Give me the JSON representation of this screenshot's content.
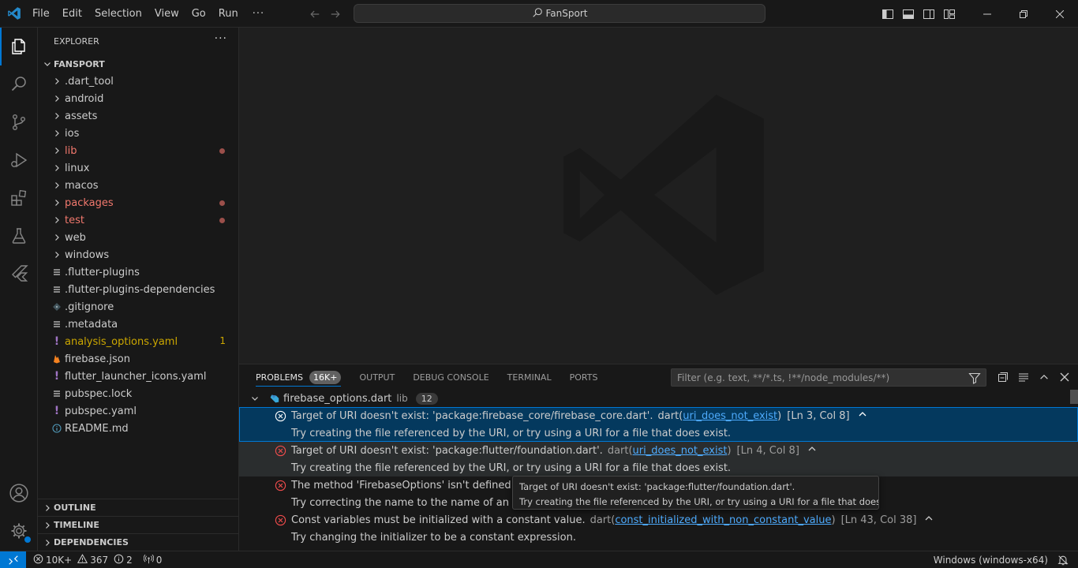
{
  "titlebar": {
    "menus": [
      "File",
      "Edit",
      "Selection",
      "View",
      "Go",
      "Run"
    ],
    "more": "···",
    "search": "FanSport"
  },
  "explorer": {
    "title": "EXPLORER",
    "more": "···",
    "project": "FANSPORT",
    "items": [
      {
        "label": ".dart_tool",
        "kind": "folder"
      },
      {
        "label": "android",
        "kind": "folder"
      },
      {
        "label": "assets",
        "kind": "folder"
      },
      {
        "label": "ios",
        "kind": "folder"
      },
      {
        "label": "lib",
        "kind": "folder",
        "status": "error"
      },
      {
        "label": "linux",
        "kind": "folder"
      },
      {
        "label": "macos",
        "kind": "folder"
      },
      {
        "label": "packages",
        "kind": "folder",
        "status": "error"
      },
      {
        "label": "test",
        "kind": "folder",
        "status": "error"
      },
      {
        "label": "web",
        "kind": "folder"
      },
      {
        "label": "windows",
        "kind": "folder"
      },
      {
        "label": ".flutter-plugins",
        "kind": "file",
        "icon": "lines-icon"
      },
      {
        "label": ".flutter-plugins-dependencies",
        "kind": "file",
        "icon": "lines-icon"
      },
      {
        "label": ".gitignore",
        "kind": "file",
        "icon": "git-icon"
      },
      {
        "label": ".metadata",
        "kind": "file",
        "icon": "lines-icon"
      },
      {
        "label": "analysis_options.yaml",
        "kind": "file",
        "icon": "yaml-icon",
        "status": "warning",
        "count": "1"
      },
      {
        "label": "firebase.json",
        "kind": "file",
        "icon": "firebase-icon"
      },
      {
        "label": "flutter_launcher_icons.yaml",
        "kind": "file",
        "icon": "yaml-icon"
      },
      {
        "label": "pubspec.lock",
        "kind": "file",
        "icon": "lines-icon"
      },
      {
        "label": "pubspec.yaml",
        "kind": "file",
        "icon": "yaml-icon"
      },
      {
        "label": "README.md",
        "kind": "file",
        "icon": "info-icon"
      }
    ],
    "sections": [
      "OUTLINE",
      "TIMELINE",
      "DEPENDENCIES"
    ]
  },
  "panel": {
    "tabs": [
      "PROBLEMS",
      "OUTPUT",
      "DEBUG CONSOLE",
      "TERMINAL",
      "PORTS"
    ],
    "problems_badge": "16K+",
    "filter_placeholder": "Filter (e.g. text, **/*.ts, !**/node_modules/**)",
    "file": {
      "name": "firebase_options.dart",
      "dir": "lib",
      "count": "12"
    },
    "problems": [
      {
        "message": "Target of URI doesn't exist: 'package:firebase_core/firebase_core.dart'.",
        "source": "dart(",
        "code": "uri_does_not_exist",
        "close": ")",
        "location": "[Ln 3, Col 8]",
        "hint": "Try creating the file referenced by the URI, or try using a URI for a file that does exist."
      },
      {
        "message": "Target of URI doesn't exist: 'package:flutter/foundation.dart'.",
        "source": "dart(",
        "code": "uri_does_not_exist",
        "close": ")",
        "location": "[Ln 4, Col 8]",
        "hint": "Try creating the file referenced by the URI, or try using a URI for a file that does exist."
      },
      {
        "message": "The method 'FirebaseOptions' isn't defined for th",
        "hint": "Try correcting the name to the name of an existin"
      },
      {
        "message": "Const variables must be initialized with a constant value.",
        "source": "dart(",
        "code": "const_initialized_with_non_constant_value",
        "close": ")",
        "location": "[Ln 43, Col 38]",
        "hint": "Try changing the initializer to be a constant expression."
      }
    ],
    "tooltip": {
      "line1": "Target of URI doesn't exist: 'package:flutter/foundation.dart'.",
      "line2": "Try creating the file referenced by the URI, or try using a URI for a file that does exist."
    }
  },
  "statusbar": {
    "errors": "10K+",
    "warnings": "367",
    "infos": "2",
    "ports": "0",
    "platform": "Windows (windows-x64)"
  },
  "colors": {
    "accent": "#0078d4",
    "error": "#f1786d",
    "warning": "#cca700",
    "link": "#4daafc"
  }
}
